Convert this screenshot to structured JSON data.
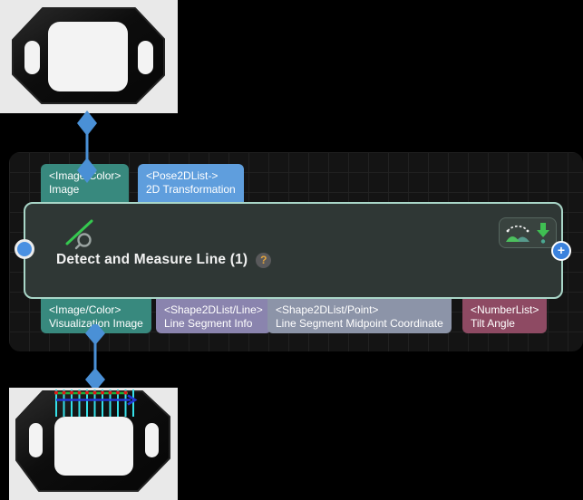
{
  "canvas": {
    "kind": "vision-node-graph-editor"
  },
  "node": {
    "title": "Detect and Measure Line (1)",
    "help_badge": "?",
    "inputs": [
      {
        "type": "<Image/Color>",
        "name": "Image",
        "color": "#38897e"
      },
      {
        "type": "<Pose2DList->",
        "name": "2D Transformation",
        "color": "#5f9edd"
      }
    ],
    "outputs": [
      {
        "type": "<Image/Color>",
        "name": "Visualization Image",
        "color": "#38897e"
      },
      {
        "type": "<Shape2DList/Line>",
        "name": "Line Segment Info",
        "color": "#8a84ae"
      },
      {
        "type": "<Shape2DList/Point>",
        "name": "Line Segment Midpoint Coordinate",
        "color": "#8c94a8"
      },
      {
        "type": "<NumberList>",
        "name": "Tilt Angle",
        "color": "#8e4a63"
      }
    ],
    "add_port_icon": "+",
    "toolbar_icons": [
      "visualization-image-icon",
      "download-arrow-icon"
    ]
  },
  "colors": {
    "connector_blue": "#4a90d6",
    "node_border": "#a9d6c8",
    "node_fill": "#2f3735",
    "canvas_bg": "#141414",
    "overlay_scanline": "#35e0e8",
    "overlay_edge_point": "#e01818",
    "overlay_fit_line": "#19b337",
    "overlay_direction": "#2238d4"
  }
}
